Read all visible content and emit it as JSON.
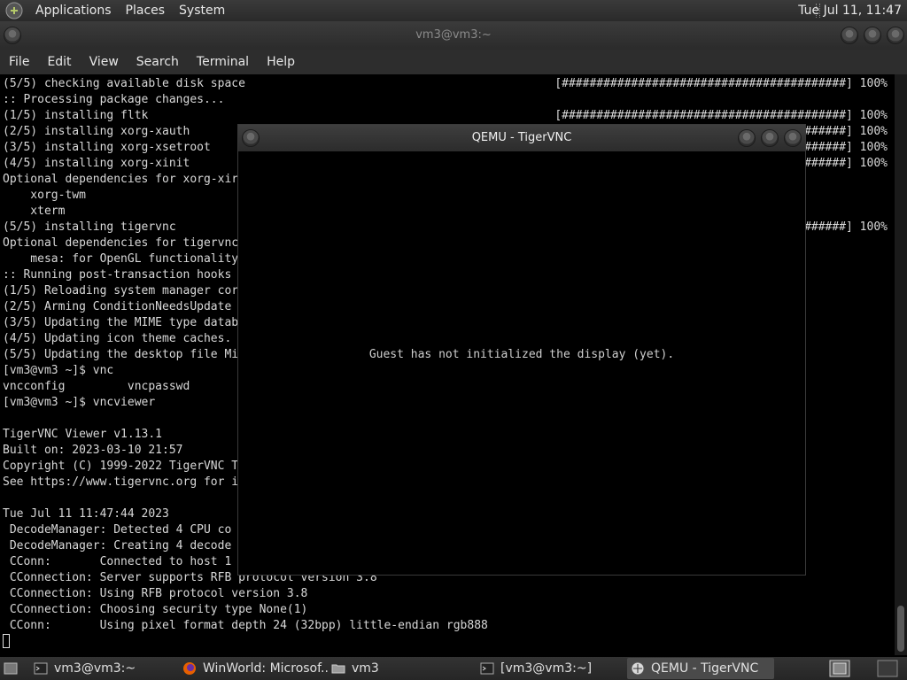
{
  "top_panel": {
    "menus": [
      "Applications",
      "Places",
      "System"
    ],
    "clock": "Tue Jul 11, 11:47"
  },
  "terminal": {
    "title": "vm3@vm3:~",
    "menu": [
      "File",
      "Edit",
      "View",
      "Search",
      "Terminal",
      "Help"
    ],
    "lines": [
      "(5/5) checking available disk space",
      ":: Processing package changes...",
      "(1/5) installing fltk",
      "(2/5) installing xorg-xauth",
      "(3/5) installing xorg-xsetroot",
      "(4/5) installing xorg-xinit",
      "Optional dependencies for xorg-xir",
      "    xorg-twm",
      "    xterm",
      "(5/5) installing tigervnc",
      "Optional dependencies for tigervnc",
      "    mesa: for OpenGL functionality",
      ":: Running post-transaction hooks",
      "(1/5) Reloading system manager cor",
      "(2/5) Arming ConditionNeedsUpdate",
      "(3/5) Updating the MIME type datab",
      "(4/5) Updating icon theme caches.",
      "(5/5) Updating the desktop file Mi",
      "[vm3@vm3 ~]$ vnc",
      "vncconfig         vncpasswd",
      "[vm3@vm3 ~]$ vncviewer",
      "",
      "TigerVNC Viewer v1.13.1",
      "Built on: 2023-03-10 21:57",
      "Copyright (C) 1999-2022 TigerVNC T",
      "See https://www.tigervnc.org for i",
      "",
      "Tue Jul 11 11:47:44 2023",
      " DecodeManager: Detected 4 CPU co",
      " DecodeManager: Creating 4 decode",
      " CConn:       Connected to host 1",
      " CConnection: Server supports RFB protocol version 3.8",
      " CConnection: Using RFB protocol version 3.8",
      " CConnection: Choosing security type None(1)",
      " CConn:       Using pixel format depth 24 (32bpp) little-endian rgb888"
    ],
    "progress": [
      "[#########################################] 100%",
      "[#########################################] 100%",
      "[#########################################] 100%",
      "[#########################################] 100%",
      "[#########################################] 100%",
      "[#########################################] 100%"
    ]
  },
  "qemu": {
    "title": "QEMU - TigerVNC",
    "message": "Guest has not initialized the display (yet)."
  },
  "taskbar": {
    "items": [
      {
        "label": "vm3@vm3:~",
        "icon": "terminal-icon"
      },
      {
        "label": "WinWorld: Microsof...",
        "icon": "firefox-icon"
      },
      {
        "label": "vm3",
        "icon": "folder-icon"
      },
      {
        "label": "[vm3@vm3:~]",
        "icon": "terminal-icon"
      },
      {
        "label": "QEMU - TigerVNC",
        "icon": "tigervnc-icon"
      }
    ]
  }
}
